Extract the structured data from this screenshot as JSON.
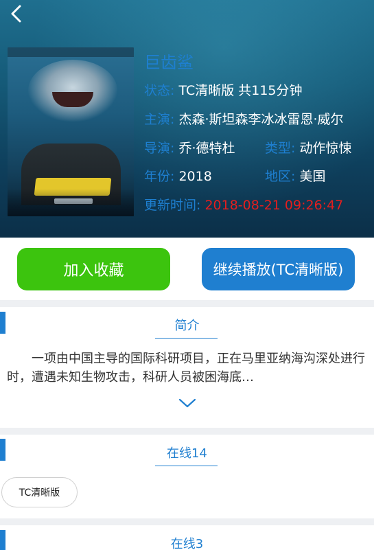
{
  "header": {
    "back_icon": "back-chevron-icon"
  },
  "movie": {
    "title": "巨齿鲨",
    "status_label": "状态:",
    "status_value": "TC清晰版 共115分钟",
    "cast_label": "主演:",
    "cast_value": "杰森·斯坦森李冰冰雷恩·威尔",
    "director_label": "导演:",
    "director_value": "乔·德特杜",
    "genre_label": "类型:",
    "genre_value": "动作惊悚",
    "year_label": "年份:",
    "year_value": "2018",
    "region_label": "地区:",
    "region_value": "美国",
    "updated_label": "更新时间:",
    "updated_value": "2018-08-21 09:26:47"
  },
  "actions": {
    "favorite_label": "加入收藏",
    "continue_label": "继续播放(TC清晰版)"
  },
  "synopsis": {
    "heading": "简介",
    "text": "一项由中国主导的国际科研项目，正在马里亚纳海沟深处进行时，遭遇未知生物攻击，科研人员被困海底…",
    "expand_icon": "chevron-down-icon"
  },
  "sources": [
    {
      "heading": "在线14",
      "episodes": [
        "TC清晰版"
      ]
    },
    {
      "heading": "在线3"
    }
  ],
  "colors": {
    "accent": "#1f7fd0",
    "favorite": "#3cc40e",
    "update_time": "#e51e1e"
  }
}
